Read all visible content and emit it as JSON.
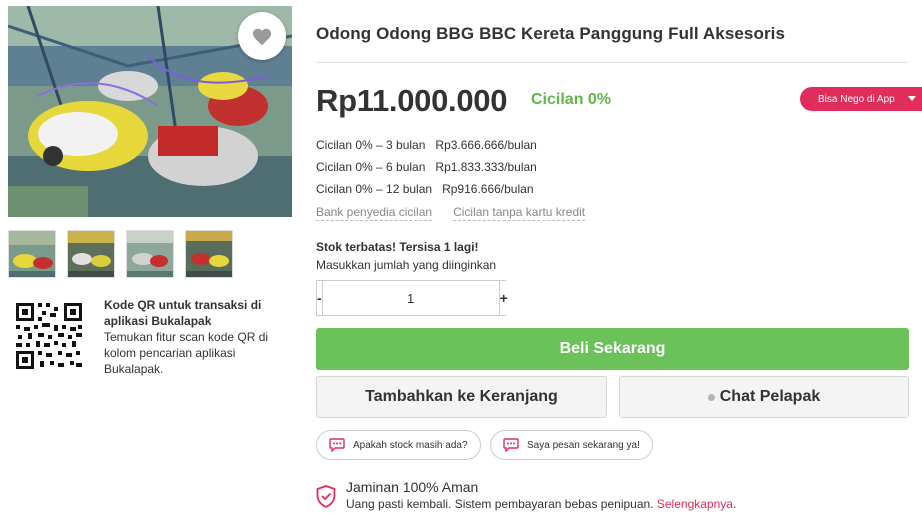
{
  "product": {
    "title": "Odong Odong BBG BBC Kereta Panggung Full Aksesoris",
    "price": "Rp11.000.000",
    "cicilan_badge": "Cicilan 0%",
    "nego_label": "Bisa Nego di App"
  },
  "installments": [
    {
      "label": "Cicilan 0% – 3 bulan",
      "amount": "Rp3.666.666/bulan"
    },
    {
      "label": "Cicilan 0% – 6 bulan",
      "amount": "Rp1.833.333/bulan"
    },
    {
      "label": "Cicilan 0% – 12 bulan",
      "amount": "Rp916.666/bulan"
    }
  ],
  "installment_links": {
    "bank": "Bank penyedia cicilan",
    "no_card": "Cicilan tanpa kartu kredit"
  },
  "stock": {
    "title": "Stok terbatas! Tersisa 1 lagi!",
    "qty_label": "Masukkan jumlah yang diinginkan",
    "minus": "-",
    "plus": "+",
    "qty_value": "1"
  },
  "actions": {
    "buy": "Beli Sekarang",
    "cart": "Tambahkan ke Keranjang",
    "chat": "Chat Pelapak"
  },
  "quick_chats": [
    "Apakah stock masih ada?",
    "Saya pesan sekarang ya!"
  ],
  "qr": {
    "title": "Kode QR untuk transaksi di aplikasi Bukalapak",
    "desc": "Temukan fitur scan kode QR di kolom pencarian aplikasi Bukalapak."
  },
  "guarantee": {
    "title": "Jaminan 100% Aman",
    "desc": "Uang pasti kembali. Sistem pembayaran bebas penipuan.",
    "link": "Selengkapnya",
    "link_suffix": "."
  },
  "icons": {
    "favorite": "heart-icon",
    "chat_bubble": "chat-bubble-icon",
    "shield": "shield-check-icon",
    "qr": "qr-code-icon"
  },
  "colors": {
    "accent_green": "#6ac259",
    "cicilan_green": "#5fb848",
    "brand_red": "#e02d5b"
  }
}
